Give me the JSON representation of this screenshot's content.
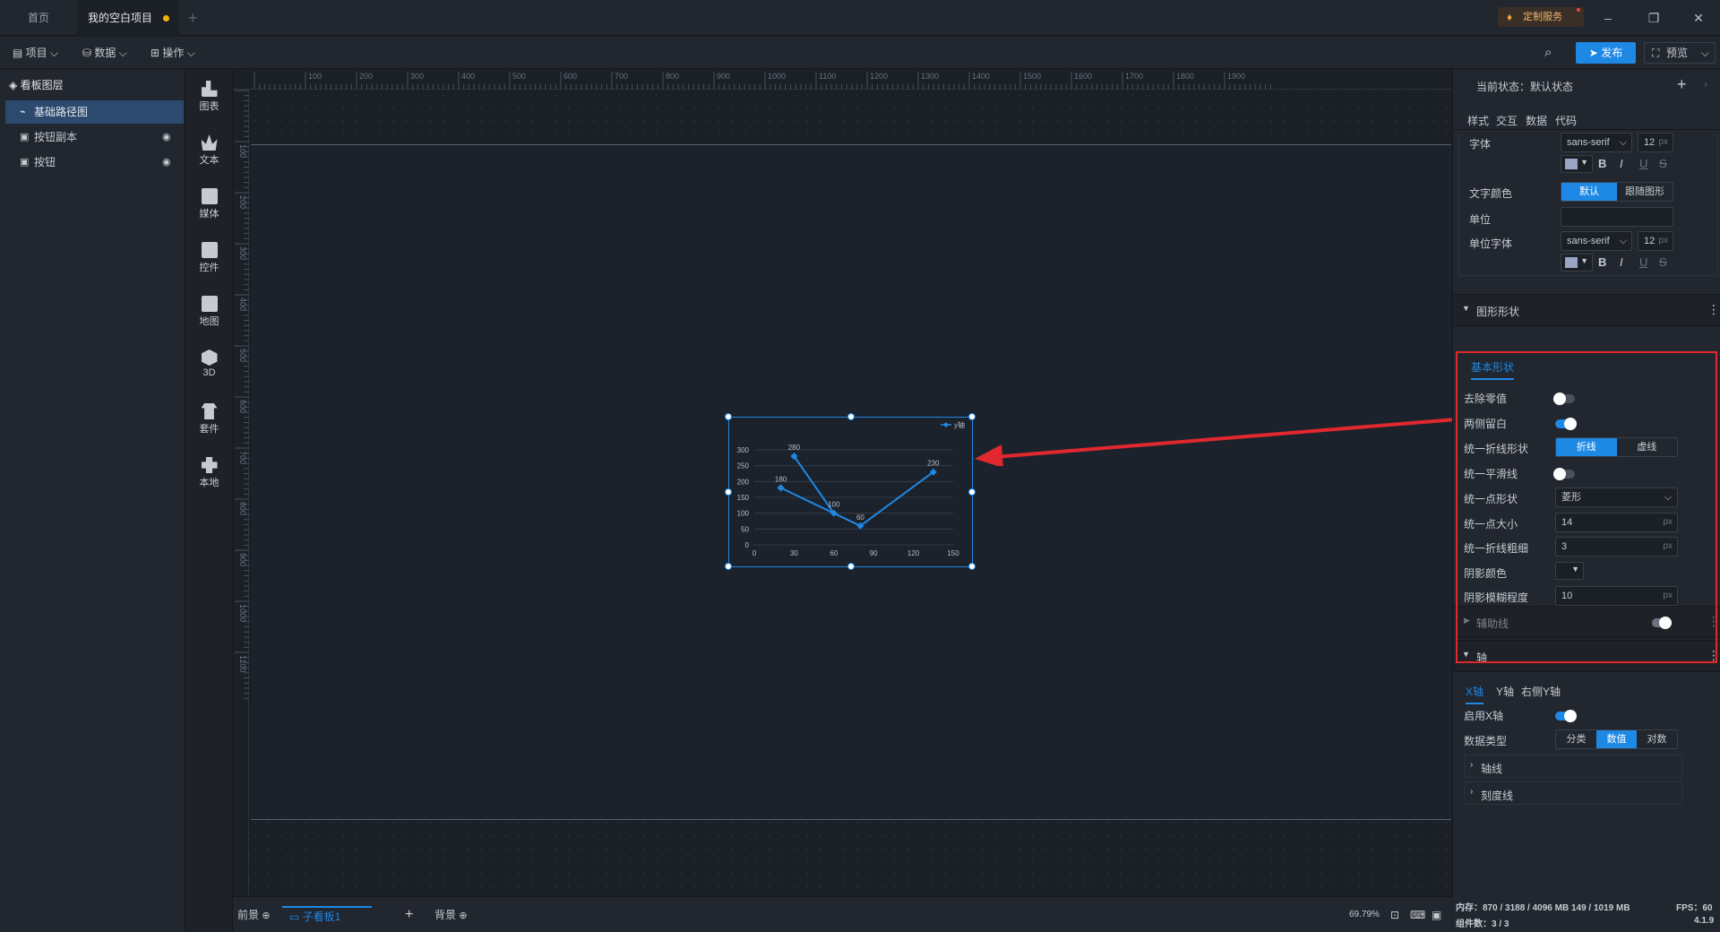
{
  "titlebar": {
    "tabs": [
      {
        "label": "首页"
      },
      {
        "label": "我的空白项目"
      }
    ],
    "service_label": "定制服务"
  },
  "toolbar": {
    "menus": [
      {
        "label": "项目"
      },
      {
        "label": "数据"
      },
      {
        "label": "操作"
      }
    ],
    "publish_label": "发布",
    "preview_label": "预览"
  },
  "layers": {
    "title": "看板图层",
    "items": [
      {
        "label": "基础路径图"
      },
      {
        "label": "按钮副本"
      },
      {
        "label": "按钮"
      }
    ]
  },
  "components": [
    {
      "label": "图表"
    },
    {
      "label": "文本"
    },
    {
      "label": "媒体"
    },
    {
      "label": "控件"
    },
    {
      "label": "地图"
    },
    {
      "label": "3D"
    },
    {
      "label": "套件"
    },
    {
      "label": "本地"
    }
  ],
  "ruler": {
    "top_ticks": [
      "100",
      "200",
      "300",
      "400",
      "500",
      "600",
      "700",
      "800",
      "900",
      "1000",
      "1100",
      "1200",
      "1300",
      "1400",
      "1500",
      "1600",
      "1700",
      "1800",
      "1900"
    ],
    "left_ticks": [
      "100",
      "200",
      "300",
      "400",
      "500",
      "600",
      "700",
      "800",
      "900",
      "1000",
      "1100"
    ]
  },
  "chart_data": {
    "type": "line",
    "legend": "y轴",
    "legend_position": "top-right",
    "x": [
      30,
      60,
      20,
      80,
      135
    ],
    "y": [
      280,
      100,
      180,
      60,
      230
    ],
    "data_labels": [
      "280",
      "100",
      "180",
      "60",
      "230"
    ],
    "xticks": [
      "0",
      "30",
      "60",
      "90",
      "120",
      "150"
    ],
    "yticks": [
      "0",
      "50",
      "100",
      "150",
      "200",
      "250",
      "300"
    ],
    "xlim": [
      0,
      150
    ],
    "ylim": [
      0,
      300
    ],
    "color": "#1e88e5"
  },
  "bottom": {
    "tabs": [
      {
        "label": "前景"
      },
      {
        "label": "子看板1"
      },
      {
        "label": "背景"
      }
    ],
    "zoom": "69.79%"
  },
  "status": {
    "memory": "内存：870 / 3188 / 4096 MB  149 / 1019 MB",
    "fps": "FPS：60",
    "components": "组件数：3 / 3",
    "version": "4.1.9"
  },
  "panel": {
    "state_label": "当前状态：默认状态",
    "tabs": [
      {
        "label": "样式"
      },
      {
        "label": "交互"
      },
      {
        "label": "数据"
      },
      {
        "label": "代码"
      }
    ],
    "font_label": "字体",
    "font_family": "sans-serif",
    "font_size": "12",
    "unit_px": "px",
    "text_color_label": "文字颜色",
    "text_color_options": [
      "默认",
      "跟随图形"
    ],
    "unit_label": "单位",
    "unit_font_label": "单位字体",
    "unit_font_family": "sans-serif",
    "unit_font_size": "12",
    "shape_section": "图形形状",
    "basic_shape_tab": "基本形状",
    "remove_zero": "去除零值",
    "side_gap": "两侧留白",
    "line_shape_label": "统一折线形状",
    "line_shape_options": [
      "折线",
      "虚线"
    ],
    "smooth_label": "统一平滑线",
    "point_shape_label": "统一点形状",
    "point_shape_value": "菱形",
    "point_size_label": "统一点大小",
    "point_size_value": "14",
    "line_width_label": "统一折线粗细",
    "line_width_value": "3",
    "shadow_color_label": "阴影颜色",
    "shadow_blur_label": "阴影模糊程度",
    "shadow_blur_value": "10",
    "aux_section": "辅助线",
    "axis_section": "轴",
    "axis_tabs": [
      {
        "label": "X轴"
      },
      {
        "label": "Y轴"
      },
      {
        "label": "右侧Y轴"
      }
    ],
    "enable_x": "启用X轴",
    "data_type_label": "数据类型",
    "data_type_options": [
      "分类",
      "数值",
      "对数"
    ],
    "axis_line": "轴线",
    "tick_line": "刻度线"
  },
  "colors": {
    "accent": "#1e88e5",
    "highlight": "#e0282e",
    "bg": "#1b1f26"
  }
}
